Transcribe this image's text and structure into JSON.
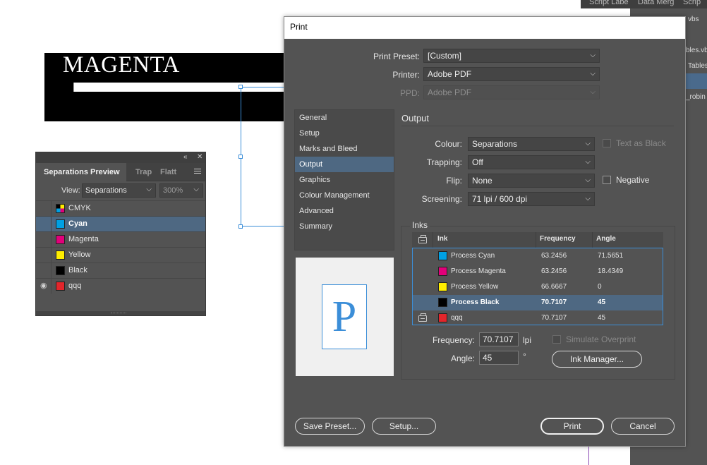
{
  "document": {
    "title": "MAGENTA"
  },
  "bg_panel": {
    "tabs": [
      "Script Labe",
      "Data Merg",
      "Scrip"
    ],
    "items": [
      "vbs",
      "bles.vb",
      "Tables",
      "_robin"
    ]
  },
  "sep_panel": {
    "tabs": [
      "Separations Preview",
      "Trap",
      "Flatt"
    ],
    "view_label": "View:",
    "view_value": "Separations",
    "zoom_value": "300%",
    "rows": [
      {
        "name": "CMYK",
        "color": "multi"
      },
      {
        "name": "Cyan",
        "color": "#00a0e3"
      },
      {
        "name": "Magenta",
        "color": "#e2007a"
      },
      {
        "name": "Yellow",
        "color": "#ffed00"
      },
      {
        "name": "Black",
        "color": "#000000"
      },
      {
        "name": "qqq",
        "color": "#e3262b"
      }
    ]
  },
  "dialog": {
    "title": "Print",
    "print_preset_label": "Print Preset:",
    "print_preset_value": "[Custom]",
    "printer_label": "Printer:",
    "printer_value": "Adobe PDF",
    "ppd_label": "PPD:",
    "ppd_value": "Adobe PDF",
    "nav": [
      "General",
      "Setup",
      "Marks and Bleed",
      "Output",
      "Graphics",
      "Colour Management",
      "Advanced",
      "Summary"
    ],
    "preview_letter": "P",
    "output_title": "Output",
    "colour_label": "Colour:",
    "colour_value": "Separations",
    "text_as_black": "Text as Black",
    "trapping_label": "Trapping:",
    "trapping_value": "Off",
    "flip_label": "Flip:",
    "flip_value": "None",
    "negative_label": "Negative",
    "screening_label": "Screening:",
    "screening_value": "71 lpi / 600 dpi",
    "inks_title": "Inks",
    "inks_headers": {
      "ink": "Ink",
      "frequency": "Frequency",
      "angle": "Angle"
    },
    "inks": [
      {
        "name": "Process Cyan",
        "frequency": "63.2456",
        "angle": "71.5651",
        "color": "#00a0e3"
      },
      {
        "name": "Process Magenta",
        "frequency": "63.2456",
        "angle": "18.4349",
        "color": "#e2007a"
      },
      {
        "name": "Process Yellow",
        "frequency": "66.6667",
        "angle": "0",
        "color": "#ffed00"
      },
      {
        "name": "Process Black",
        "frequency": "70.7107",
        "angle": "45",
        "color": "#000000"
      },
      {
        "name": "qqq",
        "frequency": "70.7107",
        "angle": "45",
        "color": "#e3262b"
      }
    ],
    "frequency_label": "Frequency:",
    "frequency_value": "70.7107",
    "frequency_unit": "lpi",
    "angle_label": "Angle:",
    "angle_value": "45",
    "angle_unit": "°",
    "simulate_overprint": "Simulate Overprint",
    "ink_manager": "Ink Manager...",
    "save_preset": "Save Preset...",
    "setup": "Setup...",
    "print": "Print",
    "cancel": "Cancel"
  }
}
